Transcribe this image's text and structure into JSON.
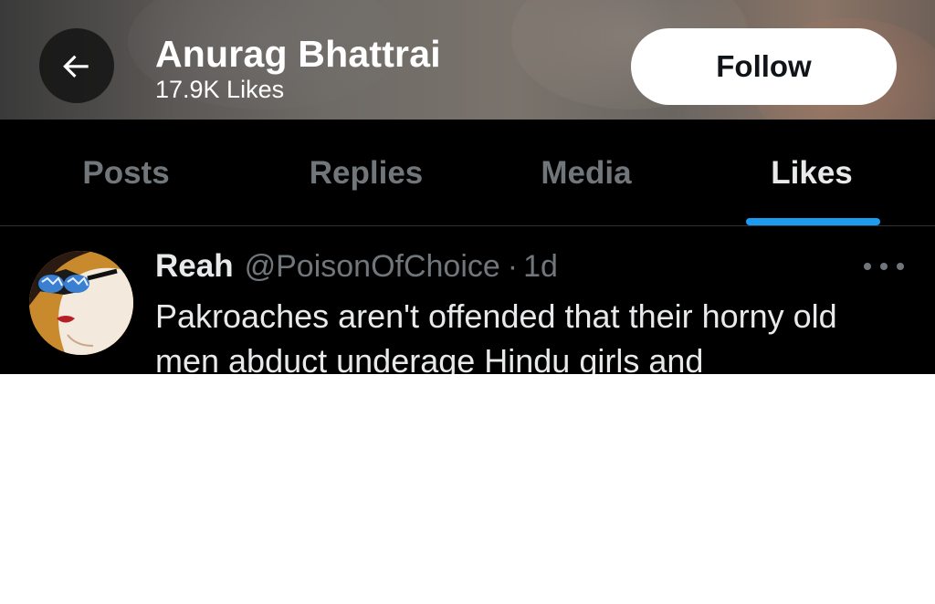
{
  "header": {
    "back_icon": "arrow-left-icon",
    "name": "Anurag Bhattrai",
    "likes_count": "17.9K Likes",
    "follow_label": "Follow"
  },
  "tabs": [
    {
      "label": "Posts",
      "active": false
    },
    {
      "label": "Replies",
      "active": false
    },
    {
      "label": "Media",
      "active": false
    },
    {
      "label": "Likes",
      "active": true
    }
  ],
  "tweet": {
    "author_name": "Reah",
    "author_handle": "@PoisonOfChoice",
    "separator": "·",
    "time": "1d",
    "more_icon": "more-horizontal-icon",
    "text": "Pakroaches aren't offended that their horny old men abduct underage Hindu girls and"
  },
  "colors": {
    "background": "#000000",
    "accent": "#1d9bf0",
    "text_primary": "#e7e9ea",
    "text_secondary": "#71767b",
    "follow_bg": "#ffffff"
  }
}
